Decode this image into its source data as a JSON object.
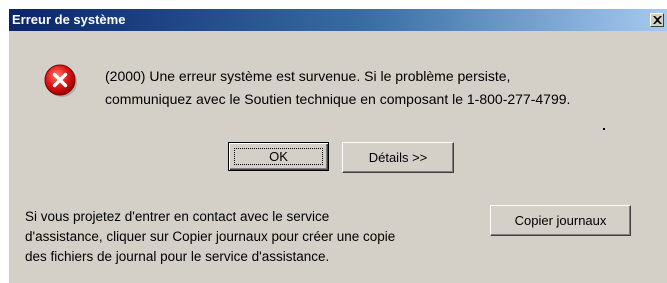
{
  "window": {
    "title": "Erreur de système"
  },
  "message": {
    "line1": "(2000) Une erreur système est survenue.  Si le problème persiste,",
    "line2": "communiquez avec le Soutien technique en composant le  1-800-277-4799."
  },
  "buttons": {
    "ok": "OK",
    "details": "Détails >>",
    "copy_logs": "Copier journaux"
  },
  "info": {
    "line1": "Si vous projetez d'entrer en contact avec le service",
    "line2": "d'assistance,  cliquer sur Copier journaux pour créer une copie",
    "line3": "des fichiers de journal  pour le service d'assistance."
  },
  "icons": {
    "error": "error-icon",
    "close": "close-icon"
  },
  "colors": {
    "titlebar_start": "#0a246a",
    "titlebar_end": "#a6caf0",
    "dialog_bg": "#d4d0c8",
    "error_red": "#e01818"
  }
}
